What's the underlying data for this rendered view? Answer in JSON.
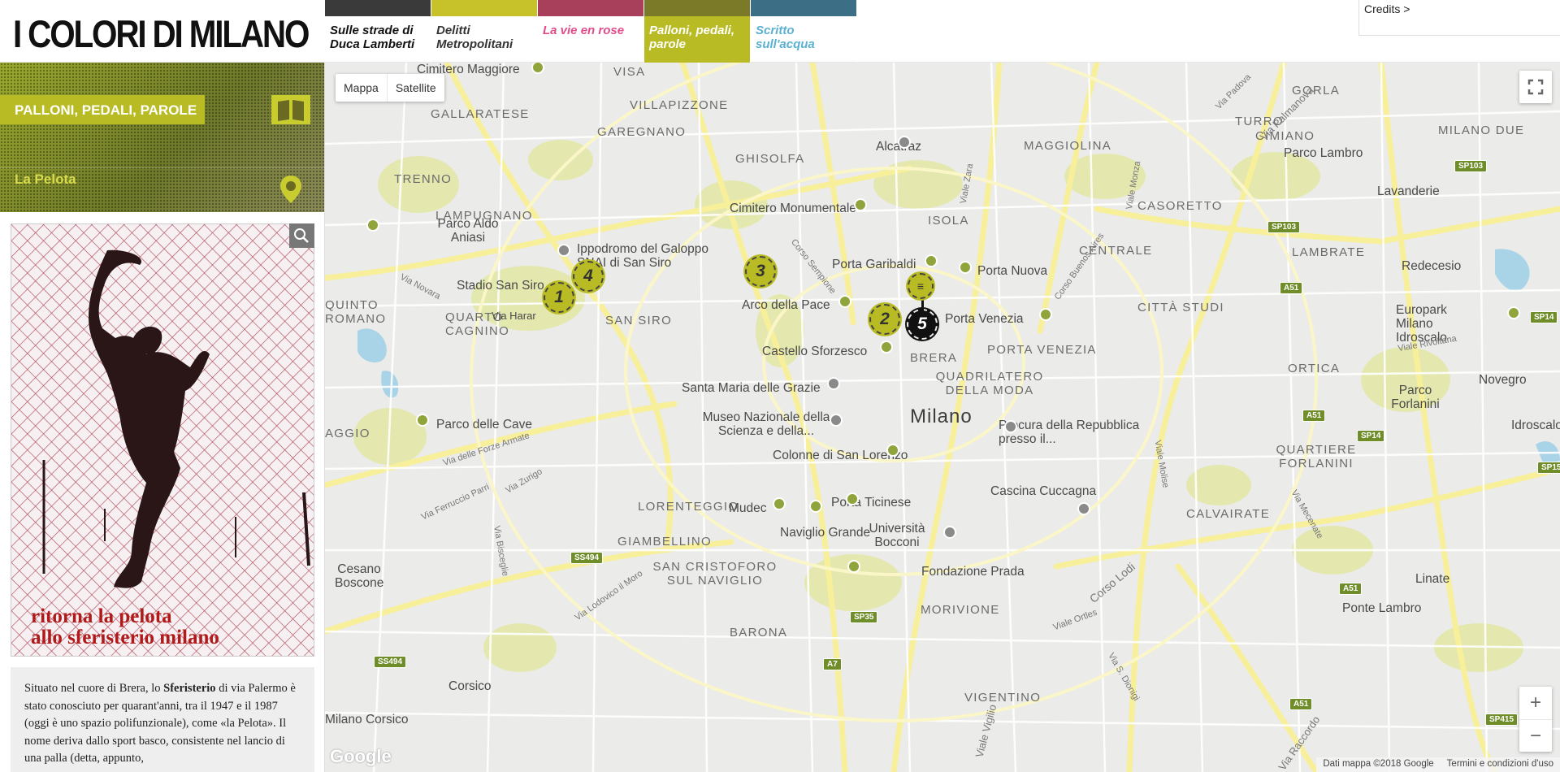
{
  "header": {
    "logo": "I COLORI DI MILANO",
    "credits": "Credits >",
    "tabs": [
      {
        "label": "Sulle strade di Duca Lamberti",
        "color": "#111111",
        "strip": "#3a3a3a"
      },
      {
        "label": "Delitti Metropolitani",
        "color": "#333333",
        "strip": "#c7c12a"
      },
      {
        "label": "La vie en rose",
        "color": "#e04e8a",
        "strip": "#a8405c"
      },
      {
        "label": "Palloni, pedali, parole",
        "color": "#ffffff",
        "strip": "#7a7a28",
        "active": true
      },
      {
        "label": "Scritto sull'acqua",
        "color": "#5ab1d0",
        "strip": "#3c6f86"
      }
    ]
  },
  "sidebar": {
    "section_title": "PALLONI, PEDALI, PAROLE",
    "section_icon": "book-icon",
    "place_title": "La Pelota",
    "place_icon": "map-pin-icon",
    "poster_line1": "ritorna la pelota",
    "poster_line2": "allo sferisterio milano",
    "zoom_icon": "magnifier-icon",
    "text_pre": "Situato nel cuore di Brera, lo ",
    "text_bold": "Sferisterio",
    "text_post": " di via Palermo è stato conosciuto per quarant'anni, tra il 1947 e il 1987 (oggi è uno spazio polifunzionale), come «la Pelota». Il nome deriva dallo sport basco, consistente nel lancio di una palla (detta, appunto,"
  },
  "map": {
    "map_type": [
      "Mappa",
      "Satellite"
    ],
    "city_label": "Milano",
    "zoom_in": "+",
    "zoom_out": "−",
    "google": "Google",
    "footer_data": "Dati mappa ©2018 Google",
    "footer_terms": "Termini e condizioni d'uso",
    "markers": [
      "1",
      "2",
      "3",
      "4",
      "5"
    ],
    "areas": [
      "VILLAPIZZONE",
      "GALLARATESE",
      "GAREGNANO",
      "GHISOLFA",
      "MAGGIOLINA",
      "TURRO",
      "CIMIANO",
      "MILANO DUE",
      "GORLA",
      "TRENNO",
      "LAMPUGNANO",
      "ISOLA",
      "CASORETTO",
      "CENTRALE",
      "LAMBRATE",
      "QUINTO ROMANO",
      "QUARTO CAGNINO",
      "SAN SIRO",
      "CITTÀ STUDI",
      "BRERA",
      "PORTA VENEZIA",
      "QUADRILATERO DELLA MODA",
      "ORTICA",
      "AGGIO",
      "QUARTIERE FORLANINI",
      "LORENTEGGIO",
      "CALVAIRATE",
      "GIAMBELLINO",
      "SAN CRISTOFORO SUL NAVIGLIO",
      "BARONA",
      "MORIVIONE",
      "VIGENTINO"
    ],
    "pois": [
      "Cimitero Maggiore",
      "Alcatraz",
      "Parco Lambro",
      "Lavanderie",
      "Parco Aldo Aniasi",
      "Cimitero Monumentale",
      "Ippodromo del Galoppo SNAI di San Siro",
      "Porta Garibaldi",
      "Porta Nuova",
      "Redecesio",
      "Stadio San Siro",
      "Arco della Pace",
      "Porta Venezia",
      "Europark Milano Idroscalo",
      "Castello Sforzesco",
      "Santa Maria delle Grazie",
      "Novegro",
      "Parco Forlanini",
      "Museo Nazionale della Scienza e della...",
      "Parco delle Cave",
      "Procura della Repubblica presso il...",
      "Idroscalo",
      "Colonne di San Lorenzo",
      "Cascina Cuccagna",
      "Mudec",
      "Porta Ticinese",
      "Università Bocconi",
      "Naviglio Grande",
      "Cesano Boscone",
      "Fondazione Prada",
      "Linate",
      "Ponte Lambro",
      "Corsico",
      "Via Harar",
      "Milano Corsico"
    ],
    "roads": [
      "Via Novara",
      "Corso Sempione",
      "Viale Zara",
      "Viale Monza",
      "Corso Buenos Aires",
      "Via Palmanova",
      "Via Padova",
      "Viale Rivoltana",
      "Viale Molise",
      "Via delle Forze Armate",
      "Via Zurigo",
      "Via Ferruccio Parri",
      "Via Bisceglie",
      "Via Lodovico il Moro",
      "Viale Ortles",
      "Corso Lodi",
      "Via Mecenate",
      "Viale Vigilio",
      "Via S. Dionigi",
      "Via Raccordo"
    ],
    "shields": [
      "SP103",
      "SP103",
      "A51",
      "SP14",
      "SP14",
      "A51",
      "A51",
      "SS494",
      "SS494",
      "SP35",
      "A7",
      "SP15",
      "A51",
      "SP415"
    ]
  }
}
